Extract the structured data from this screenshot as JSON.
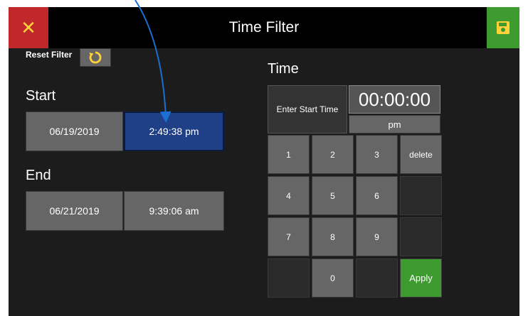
{
  "header": {
    "title": "Time Filter",
    "close_icon": "✕",
    "save_icon": "save-icon"
  },
  "reset": {
    "label": "Reset Filter",
    "icon": "refresh-icon"
  },
  "start": {
    "label": "Start",
    "date": "06/19/2019",
    "time": "2:49:38 pm"
  },
  "end": {
    "label": "End",
    "date": "06/21/2019",
    "time": "9:39:06 am"
  },
  "time_panel": {
    "title": "Time",
    "prompt": "Enter Start Time",
    "display": "00:00:00",
    "ampm": "pm"
  },
  "keypad": {
    "k1": "1",
    "k2": "2",
    "k3": "3",
    "delete": "delete",
    "k4": "4",
    "k5": "5",
    "k6": "6",
    "k7": "7",
    "k8": "8",
    "k9": "9",
    "k0": "0",
    "apply": "Apply"
  },
  "colors": {
    "accent_blue": "#1f3f86",
    "close_red": "#c0282c",
    "save_green": "#3d9b2f",
    "icon_yellow": "#ffd23a"
  }
}
